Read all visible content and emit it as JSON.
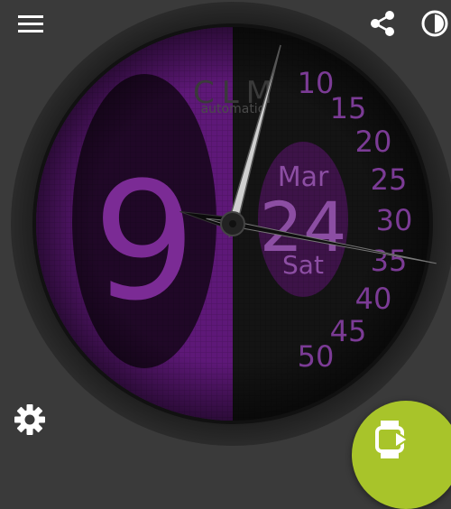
{
  "app": {
    "menu_icon": "hamburger-menu-icon",
    "share_icon": "share-icon",
    "theme_icon": "half-moon-icon",
    "settings_icon": "gear-icon",
    "fab_icon": "watch-sync-icon"
  },
  "watchface": {
    "brand": "CLM",
    "brand_sub": "automatic",
    "hour_digit": "9",
    "month": "Mar",
    "day": "24",
    "weekday": "Sat",
    "minute_scale": [
      "10",
      "15",
      "20",
      "25",
      "30",
      "35",
      "40",
      "45",
      "50"
    ],
    "hand_angles_deg": {
      "hour": 283,
      "minute": 15,
      "second": 101
    },
    "accent_color": "#6a1b86",
    "text_color": "#7b3b95",
    "background_color": "#3a3a3a",
    "fab_color": "#a8c42a"
  }
}
